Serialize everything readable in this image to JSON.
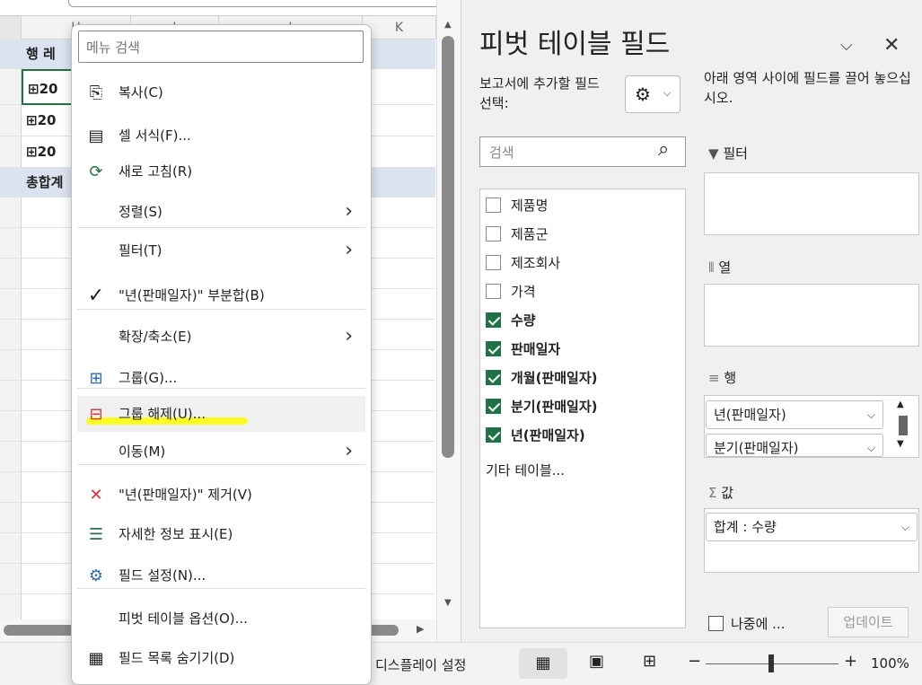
{
  "sheet": {
    "columns": [
      "H",
      "I",
      "J",
      "K"
    ],
    "row_labels": [
      "행 레",
      "⊞20",
      "⊞20",
      "⊞20",
      "총합계"
    ]
  },
  "menu": {
    "search_placeholder": "메뉴 검색",
    "items": [
      {
        "label": "복사(C)",
        "icon": "copy-icon"
      },
      {
        "label": "셀 서식(F)...",
        "icon": "format-cells-icon"
      },
      {
        "label": "새로 고침(R)",
        "icon": "refresh-icon"
      },
      {
        "label": "정렬(S)",
        "icon": "",
        "submenu": true
      },
      {
        "label": "필터(T)",
        "icon": "",
        "submenu": true
      },
      {
        "label": "\"년(판매일자)\" 부분합(B)",
        "icon": "checkmark-icon"
      },
      {
        "label": "확장/축소(E)",
        "icon": "",
        "submenu": true
      },
      {
        "label": "그룹(G)...",
        "icon": "group-icon"
      },
      {
        "label": "그룹 해제(U)...",
        "icon": "ungroup-icon"
      },
      {
        "label": "이동(M)",
        "icon": "",
        "submenu": true
      },
      {
        "label": "\"년(판매일자)\" 제거(V)",
        "icon": "remove-icon"
      },
      {
        "label": "자세한 정보 표시(E)",
        "icon": "show-details-icon"
      },
      {
        "label": "필드 설정(N)...",
        "icon": "field-settings-icon"
      },
      {
        "label": "피벗 테이블 옵션(O)...",
        "icon": ""
      },
      {
        "label": "필드 목록 숨기기(D)",
        "icon": "field-list-icon"
      }
    ]
  },
  "pane": {
    "title": "피벗 테이블 필드",
    "choose_label": "보고서에 추가할 필드 선택:",
    "drag_hint": "아래 영역 사이에 필드를 끌어 놓으십시오.",
    "search_placeholder": "검색",
    "fields": [
      {
        "name": "제품명",
        "checked": false
      },
      {
        "name": "제품군",
        "checked": false
      },
      {
        "name": "제조회사",
        "checked": false
      },
      {
        "name": "가격",
        "checked": false
      },
      {
        "name": "수량",
        "checked": true
      },
      {
        "name": "판매일자",
        "checked": true
      },
      {
        "name": "개월(판매일자)",
        "checked": true
      },
      {
        "name": "분기(판매일자)",
        "checked": true
      },
      {
        "name": "년(판매일자)",
        "checked": true
      }
    ],
    "more_tables": "기타 테이블...",
    "areas": {
      "filter": "필터",
      "columns": "열",
      "rows": "행",
      "values": "값"
    },
    "row_items": [
      "년(판매일자)",
      "분기(판매일자)"
    ],
    "value_items": [
      "합계 : 수량"
    ],
    "defer_label": "나중에 ...",
    "update_label": "업데이트"
  },
  "status": {
    "display_settings": "디스플레이 설정",
    "zoom": "100%"
  },
  "colors": {
    "accent": "#217346",
    "highlight": "#ffff00"
  }
}
